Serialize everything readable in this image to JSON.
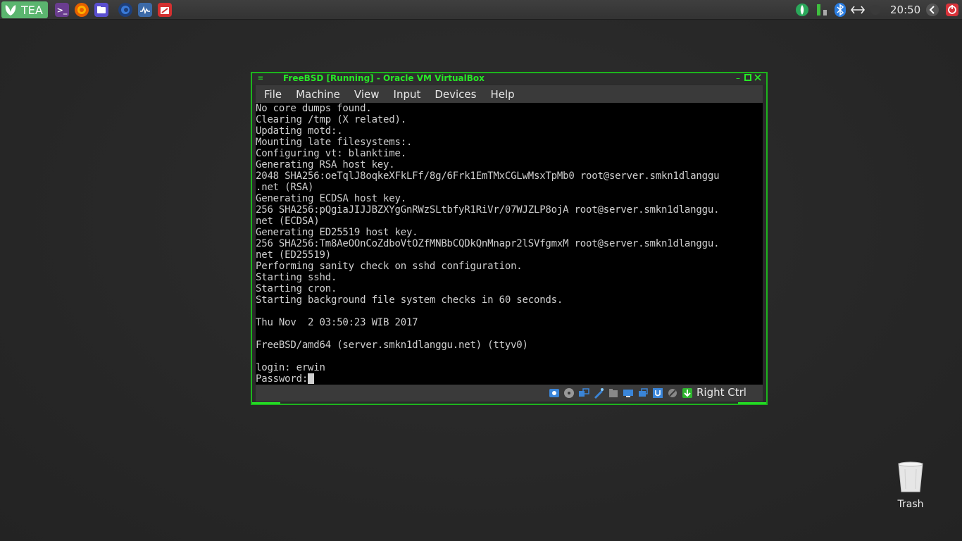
{
  "panel": {
    "menu_label": "TEA",
    "launchers": [
      {
        "icon": "terminal-icon",
        "color": "#6a3d8f"
      },
      {
        "icon": "firefox-icon",
        "color": "#e66000"
      },
      {
        "icon": "file-manager-icon",
        "color": "#5a4fcf"
      },
      {
        "icon": "browser-icon",
        "color": "#2a5aa8"
      },
      {
        "icon": "system-monitor-icon",
        "color": "#3c6aa8"
      },
      {
        "icon": "virtualbox-icon",
        "color": "#d43030"
      }
    ],
    "tray": [
      "network-shield-icon",
      "usb-battery-icon",
      "bluetooth-icon",
      "network-arrows-icon"
    ],
    "clock": "20:50"
  },
  "window": {
    "title": "FreeBSD [Running] - Oracle VM VirtualBox",
    "menu": [
      "File",
      "Machine",
      "View",
      "Input",
      "Devices",
      "Help"
    ],
    "console_lines": [
      "No core dumps found.",
      "Clearing /tmp (X related).",
      "Updating motd:.",
      "Mounting late filesystems:.",
      "Configuring vt: blanktime.",
      "Generating RSA host key.",
      "2048 SHA256:oeTqlJ8oqkeXFkLFf/8g/6Frk1EmTMxCGLwMsxTpMb0 root@server.smkn1dlanggu",
      ".net (RSA)",
      "Generating ECDSA host key.",
      "256 SHA256:pQgiaJIJJBZXYgGnRWzSLtbfyR1RiVr/07WJZLP8ojA root@server.smkn1dlanggu.",
      "net (ECDSA)",
      "Generating ED25519 host key.",
      "256 SHA256:Tm8AeOOnCoZdboVtOZfMNBbCQDkQnMnapr2lSVfgmxM root@server.smkn1dlanggu.",
      "net (ED25519)",
      "Performing sanity check on sshd configuration.",
      "Starting sshd.",
      "Starting cron.",
      "Starting background file system checks in 60 seconds.",
      "",
      "Thu Nov  2 03:50:23 WIB 2017",
      "",
      "FreeBSD/amd64 (server.smkn1dlanggu.net) (ttyv0)",
      "",
      "login: erwin"
    ],
    "password_prompt": "Password:",
    "status_icons": [
      "hard-disk-icon",
      "optical-drive-icon",
      "audio-icon",
      "network-icon",
      "usb-icon",
      "shared-folder-icon",
      "display-icon",
      "recording-icon",
      "vt-x-icon",
      "mouse-integration-icon",
      "keyboard-icon"
    ],
    "host_key": "Right Ctrl"
  },
  "desktop": {
    "trash_label": "Trash"
  },
  "colors": {
    "accent": "#27e827",
    "menu_green": "#5bb56f"
  }
}
